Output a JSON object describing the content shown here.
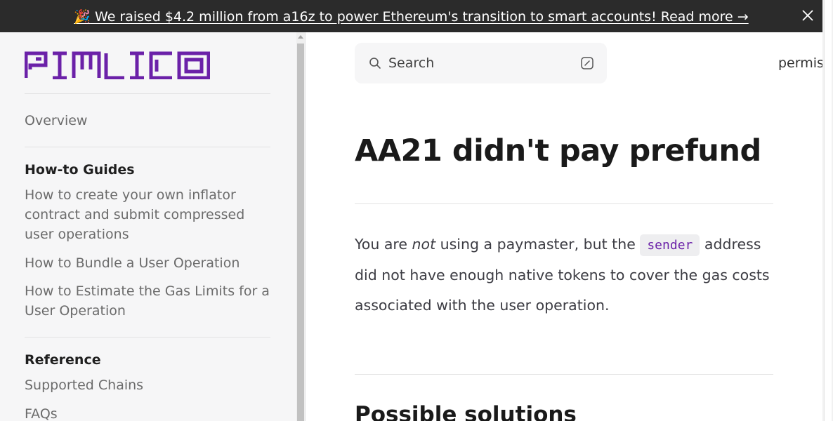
{
  "banner": {
    "emoji": "🎉",
    "text": "We raised $4.2 million from a16z to power Ethereum's transition to smart accounts! Read more →"
  },
  "brand": {
    "name": "PIMLICO",
    "color": "#6b21a8"
  },
  "sidebar": {
    "overview": "Overview",
    "sections": [
      {
        "heading": "How-to Guides",
        "links": [
          "How to create your own inflator contract and submit compressed user operations",
          "How to Bundle a User Operation",
          "How to Estimate the Gas Limits for a User Operation"
        ]
      },
      {
        "heading": "Reference",
        "links": [
          "Supported Chains",
          "FAQs"
        ]
      }
    ]
  },
  "search": {
    "placeholder": "Search",
    "icon": "search-icon",
    "shortcut_icon": "slash-key-icon"
  },
  "nav": {
    "partial_item": "permis"
  },
  "content": {
    "title": "AA21 didn't pay prefund",
    "para_part1": "You are ",
    "para_em": "not",
    "para_part2": " using a paymaster, but the ",
    "para_code": "sender",
    "para_part3": " address did not have enough native tokens to cover the gas costs associated with the user operation.",
    "subheading": "Possible solutions"
  }
}
